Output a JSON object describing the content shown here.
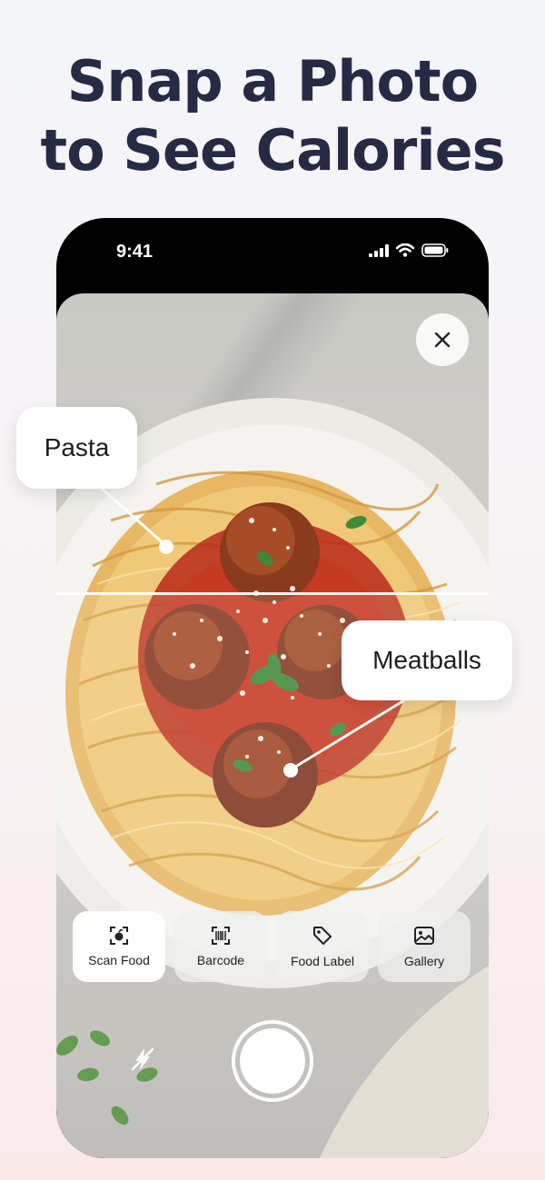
{
  "headline": {
    "line1": "Snap a Photo",
    "line2": "to See Calories"
  },
  "status_bar": {
    "time": "9:41"
  },
  "labels": {
    "pasta": "Pasta",
    "meatballs": "Meatballs"
  },
  "tools": [
    {
      "label": "Scan Food",
      "icon": "scan-food-icon",
      "active": true
    },
    {
      "label": "Barcode",
      "icon": "barcode-icon",
      "active": false
    },
    {
      "label": "Food Label",
      "icon": "tag-icon",
      "active": false
    },
    {
      "label": "Gallery",
      "icon": "gallery-icon",
      "active": false
    }
  ],
  "colors": {
    "headline": "#272a45",
    "accent_white": "#ffffff"
  }
}
